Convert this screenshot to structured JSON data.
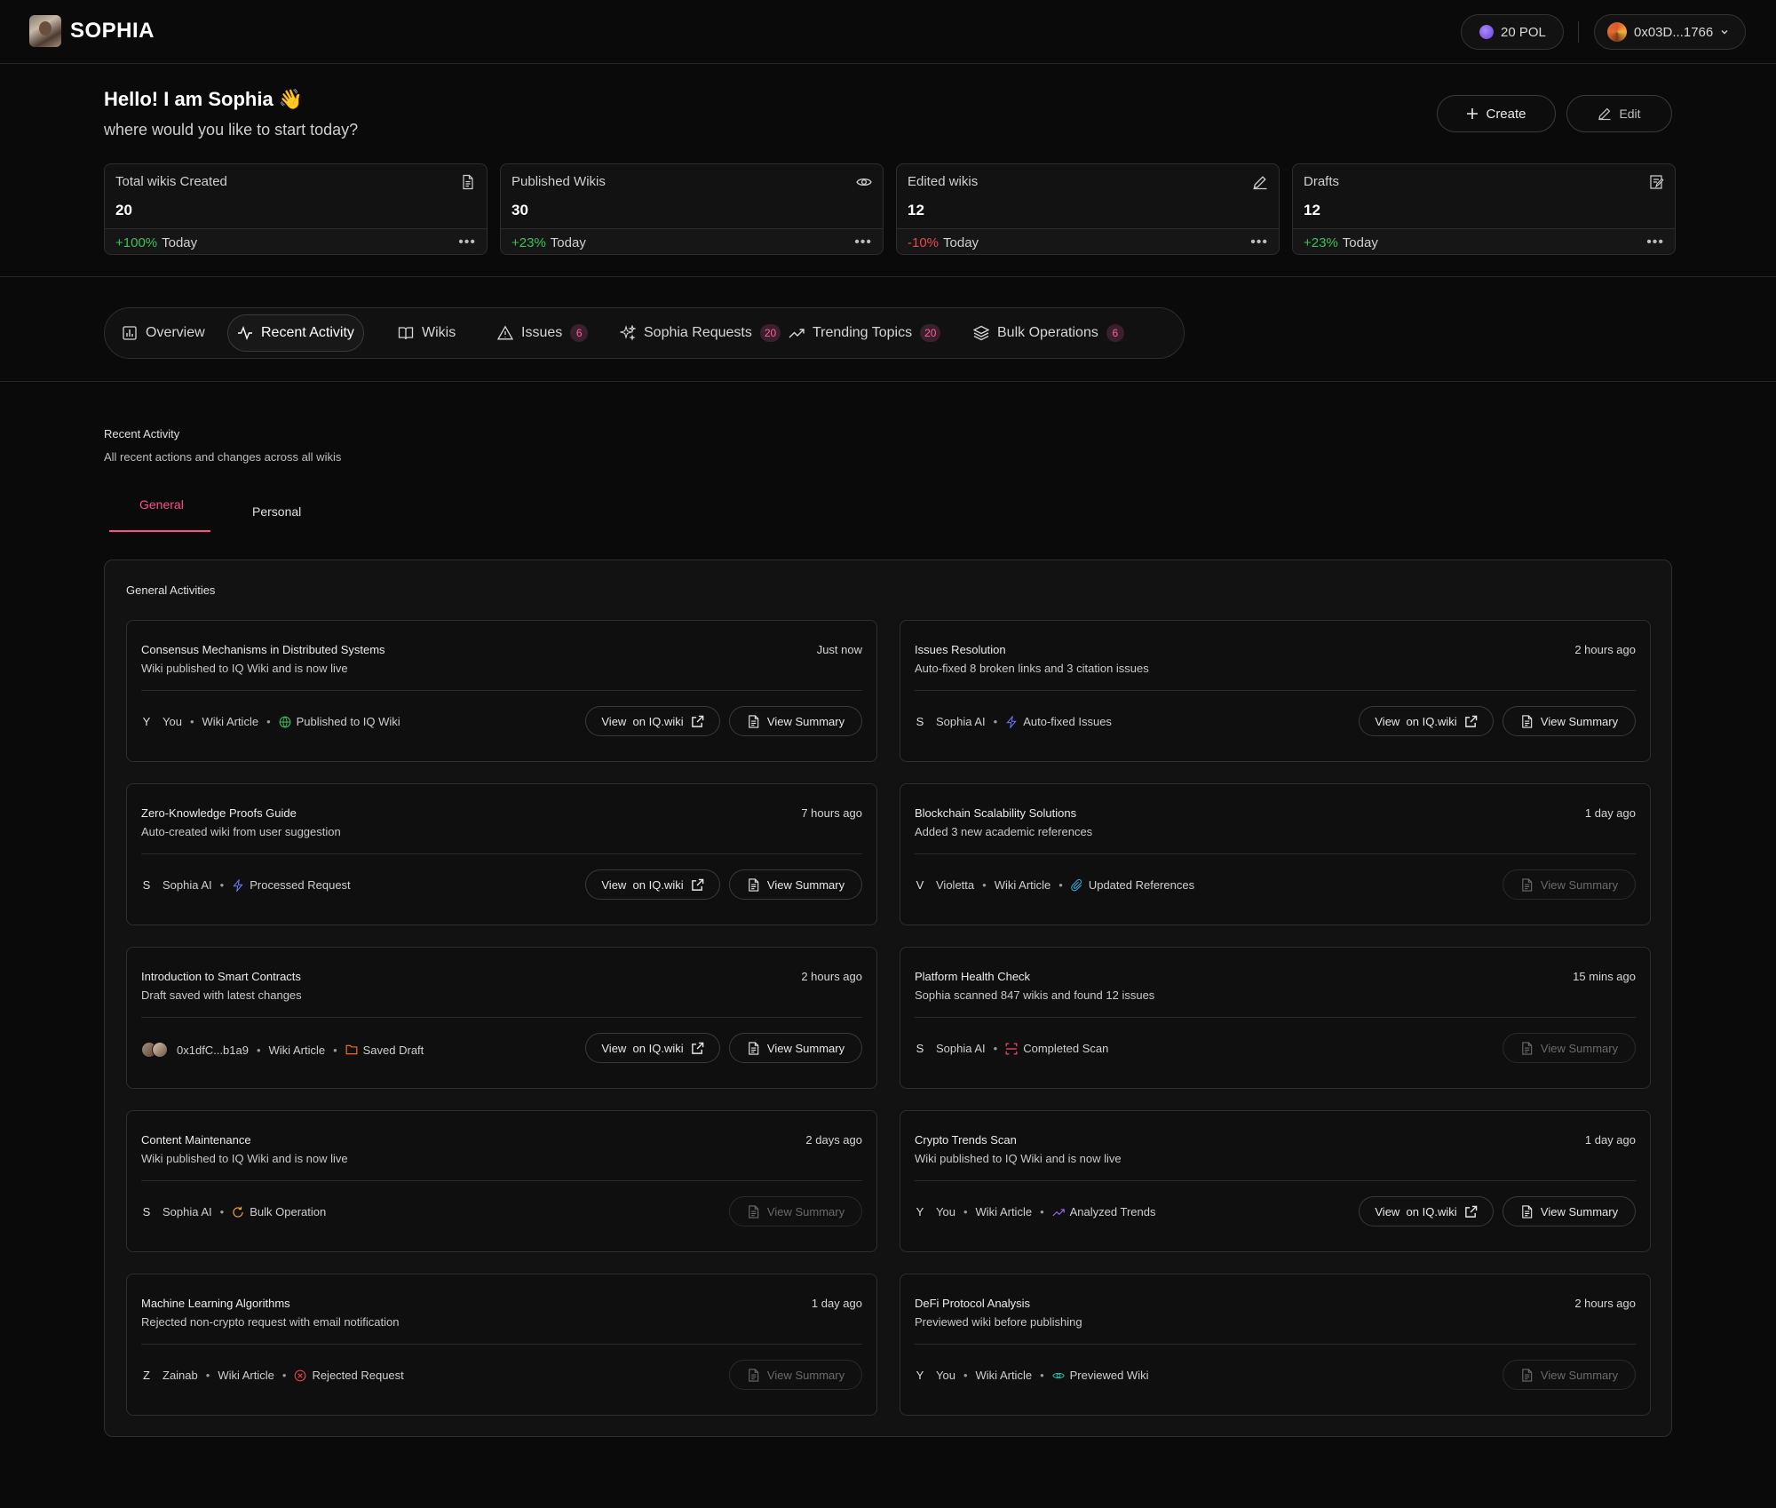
{
  "brand": {
    "name": "SOPHIA"
  },
  "header": {
    "balance": "20 POL",
    "wallet": "0x03D...1766"
  },
  "greeting": {
    "title": "Hello! I am Sophia 👋",
    "subtitle": "where would you like to start today?"
  },
  "actions": {
    "create": "Create",
    "edit": "Edit"
  },
  "stats": [
    {
      "label": "Total wikis Created",
      "value": "20",
      "change": "+100%",
      "direction": "up",
      "period": "Today",
      "icon": "document-icon"
    },
    {
      "label": "Published Wikis",
      "value": "30",
      "change": "+23%",
      "direction": "up",
      "period": "Today",
      "icon": "eye-icon"
    },
    {
      "label": "Edited wikis",
      "value": "12",
      "change": "-10%",
      "direction": "down",
      "period": "Today",
      "icon": "pencil-icon"
    },
    {
      "label": "Drafts",
      "value": "12",
      "change": "+23%",
      "direction": "up",
      "period": "Today",
      "icon": "draft-icon"
    }
  ],
  "tabs": [
    {
      "label": "Overview",
      "icon": "bar-chart-icon"
    },
    {
      "label": "Recent Activity",
      "icon": "activity-icon",
      "active": true
    },
    {
      "label": "Wikis",
      "icon": "book-icon"
    },
    {
      "label": "Issues",
      "icon": "warning-icon",
      "badge": "6"
    },
    {
      "label": "Sophia Requests",
      "icon": "sparkles-icon",
      "badge": "20"
    },
    {
      "label": "Trending Topics",
      "icon": "trending-icon",
      "badge": "20"
    },
    {
      "label": "Bulk Operations",
      "icon": "layers-icon",
      "badge": "6"
    }
  ],
  "section": {
    "title": "Recent Activity",
    "subtitle": "All recent actions and changes across all wikis"
  },
  "subtabs": {
    "general": "General",
    "personal": "Personal"
  },
  "panel": {
    "title": "General Activities"
  },
  "labels": {
    "view_iq": "View  on IQ.wiki",
    "view_summary": "View Summary"
  },
  "colors": {
    "accent": "#ff4d8d",
    "positive": "#3fbf5f",
    "negative": "#e5484d",
    "background": "#0a0a0a"
  },
  "activities": [
    {
      "title": "Consensus Mechanisms in Distributed Systems",
      "time": "Just now",
      "desc": "Wiki published to IQ Wiki and is now live",
      "initial": "Y",
      "actor": "You",
      "type": "Wiki Article",
      "status": "Published to IQ Wiki",
      "status_icon": "globe-icon",
      "iq": true,
      "summary": true
    },
    {
      "title": "Issues Resolution",
      "time": "2 hours ago",
      "desc": "Auto-fixed 8 broken links and 3 citation issues",
      "initial": "S",
      "actor": "Sophia AI",
      "type": "",
      "status": "Auto-fixed Issues",
      "status_icon": "bolt-icon",
      "iq": true,
      "summary": true
    },
    {
      "title": "Zero-Knowledge Proofs Guide",
      "time": "7 hours ago",
      "desc": "Auto-created wiki from user suggestion",
      "initial": "S",
      "actor": "Sophia AI",
      "type": "",
      "status": "Processed Request",
      "status_icon": "bolt-icon",
      "iq": true,
      "summary": true
    },
    {
      "title": "Blockchain Scalability Solutions",
      "time": "1 day ago",
      "desc": "Added 3 new academic references",
      "initial": "V",
      "actor": "Violetta",
      "type": "Wiki Article",
      "status": "Updated References",
      "status_icon": "paperclip-icon",
      "iq": false,
      "summary": false
    },
    {
      "title": "Introduction to Smart Contracts",
      "time": "2 hours ago",
      "desc": "Draft saved with latest changes",
      "initial": "",
      "actor": "0x1dfC...b1a9",
      "type": "Wiki Article",
      "status": "Saved Draft",
      "status_icon": "folder-icon",
      "iq": true,
      "summary": true
    },
    {
      "title": "Platform Health Check",
      "time": "15 mins ago",
      "desc": "Sophia scanned 847 wikis and found 12 issues",
      "initial": "S",
      "actor": "Sophia AI",
      "type": "",
      "status": "Completed Scan",
      "status_icon": "scan-icon",
      "iq": false,
      "summary": false
    },
    {
      "title": "Content Maintenance",
      "time": "2 days ago",
      "desc": "Wiki published to IQ Wiki and is now live",
      "initial": "S",
      "actor": "Sophia AI",
      "type": "",
      "status": "Bulk Operation",
      "status_icon": "refresh-icon",
      "iq": false,
      "summary": false
    },
    {
      "title": "Crypto Trends Scan",
      "time": "1 day ago",
      "desc": "Wiki published to IQ Wiki and is now live",
      "initial": "Y",
      "actor": "You",
      "type": "Wiki Article",
      "status": "Analyzed Trends",
      "status_icon": "trending-icon",
      "iq": true,
      "summary": true
    },
    {
      "title": "Machine Learning Algorithms",
      "time": "1 day ago",
      "desc": "Rejected non-crypto request with email notification",
      "initial": "Z",
      "actor": "Zainab",
      "type": "Wiki Article",
      "status": "Rejected Request",
      "status_icon": "x-circle-icon",
      "iq": false,
      "summary": false
    },
    {
      "title": "DeFi Protocol Analysis",
      "time": "2 hours ago",
      "desc": "Previewed wiki before publishing",
      "initial": "Y",
      "actor": "You",
      "type": "Wiki Article",
      "status": "Previewed Wiki",
      "status_icon": "eye-icon",
      "iq": false,
      "summary": false
    }
  ]
}
